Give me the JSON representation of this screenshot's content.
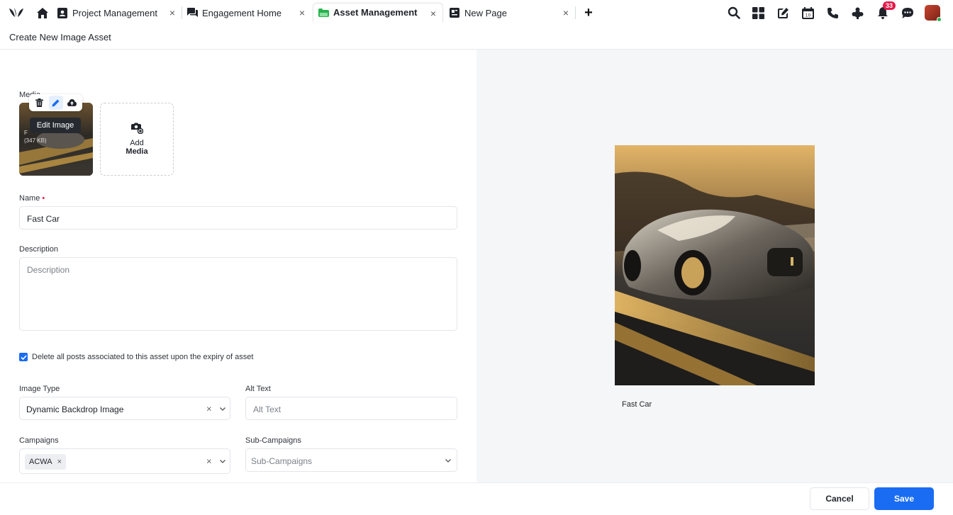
{
  "tabs": [
    {
      "label": "Project Management",
      "icon": "contact-book-icon",
      "active": false
    },
    {
      "label": "Engagement Home",
      "icon": "chat-bubbles-icon",
      "active": false
    },
    {
      "label": "Asset Management",
      "icon": "asset-folder-icon",
      "active": true
    },
    {
      "label": "New Page",
      "icon": "new-page-icon",
      "active": false
    }
  ],
  "notifications": {
    "count": "33"
  },
  "page": {
    "title": "Create New Image Asset"
  },
  "media": {
    "label": "Media",
    "thumb_name": "F",
    "thumb_size": "(347 KB)",
    "tooltip": "Edit Image",
    "add_line1": "Add",
    "add_line2": "Media"
  },
  "form": {
    "name_label": "Name",
    "name_value": "Fast Car",
    "description_label": "Description",
    "description_placeholder": "Description",
    "delete_posts_label": "Delete all posts associated to this asset upon the expiry of asset",
    "delete_posts_checked": true,
    "image_type_label": "Image Type",
    "image_type_value": "Dynamic Backdrop Image",
    "alt_text_label": "Alt Text",
    "alt_text_placeholder": "Alt Text",
    "campaigns_label": "Campaigns",
    "campaign_chip": "ACWA",
    "sub_campaigns_label": "Sub-Campaigns",
    "sub_campaigns_placeholder": "Sub-Campaigns"
  },
  "preview": {
    "caption": "Fast Car"
  },
  "footer": {
    "cancel_label": "Cancel",
    "save_label": "Save"
  },
  "colors": {
    "primary": "#1a6cf2",
    "badge": "#e5194a",
    "preview_bg": "#f5f6f8"
  }
}
